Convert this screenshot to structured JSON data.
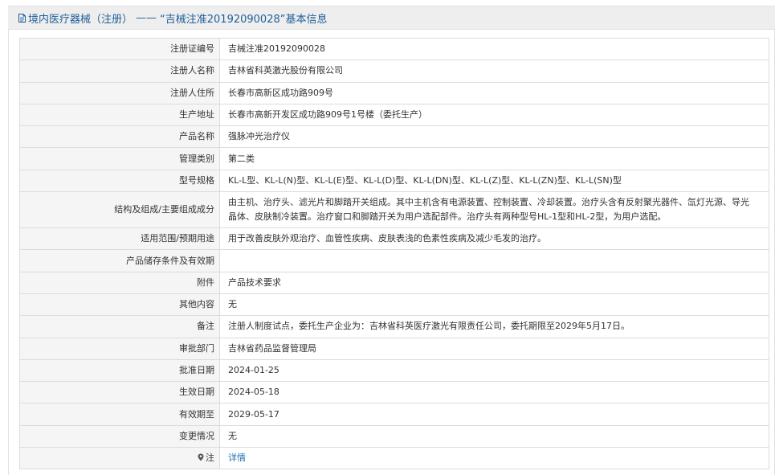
{
  "title": {
    "prefix": "境内医疗器械（注册）",
    "separator": "——",
    "main": "“吉械注准20192090028”基本信息"
  },
  "rows": [
    {
      "label": "注册证编号",
      "value": "吉械注准20192090028"
    },
    {
      "label": "注册人名称",
      "value": "吉林省科英激光股份有限公司"
    },
    {
      "label": "注册人住所",
      "value": "长春市高新区成功路909号"
    },
    {
      "label": "生产地址",
      "value": "长春市高新开发区成功路909号1号楼（委托生产）"
    },
    {
      "label": "产品名称",
      "value": "强脉冲光治疗仪"
    },
    {
      "label": "管理类别",
      "value": "第二类"
    },
    {
      "label": "型号规格",
      "value": "KL-L型、KL-L(N)型、KL-L(E)型、KL-L(D)型、KL-L(DN)型、KL-L(Z)型、KL-L(ZN)型、KL-L(SN)型"
    },
    {
      "label": "结构及组成/主要组成成分",
      "value": "由主机、治疗头、滤光片和脚踏开关组成。其中主机含有电源装置、控制装置、冷却装置。治疗头含有反射聚光器件、氙灯光源、导光晶体、皮肤制冷装置。治疗窗口和脚踏开关为用户选配部件。治疗头有两种型号HL-1型和HL-2型，为用户选配。"
    },
    {
      "label": "适用范围/预期用途",
      "value": "用于改善皮肤外观治疗、血管性疾病、皮肤表浅的色素性疾病及减少毛发的治疗。"
    },
    {
      "label": "产品储存条件及有效期",
      "value": ""
    },
    {
      "label": "附件",
      "value": "产品技术要求"
    },
    {
      "label": "其他内容",
      "value": "无"
    },
    {
      "label": "备注",
      "value": "注册人制度试点，委托生产企业为：吉林省科英医疗激光有限责任公司，委托期限至2029年5月17日。"
    },
    {
      "label": "审批部门",
      "value": "吉林省药品监督管理局"
    },
    {
      "label": "批准日期",
      "value": "2024-01-25"
    },
    {
      "label": "生效日期",
      "value": "2024-05-18"
    },
    {
      "label": "有效期至",
      "value": "2029-05-17"
    },
    {
      "label": "变更情况",
      "value": "无"
    }
  ],
  "note_row": {
    "label": "注",
    "link": "详情",
    "icon": "pin-icon"
  },
  "colors": {
    "title_text": "#1f5f9a",
    "link": "#1f6fb2",
    "label_bg": "#f5f5f5",
    "border": "#dcdcdc"
  }
}
